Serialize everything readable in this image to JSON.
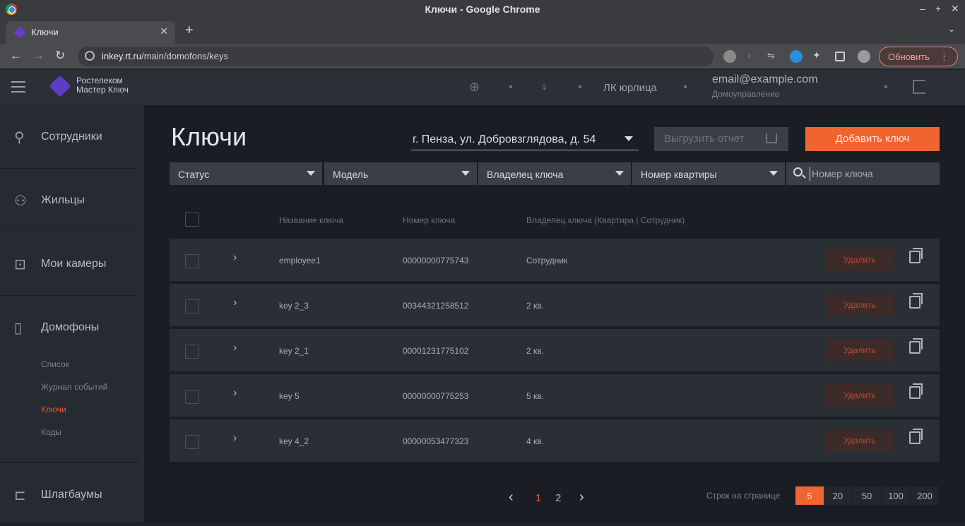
{
  "browser": {
    "window_title": "Ключи - Google Chrome",
    "tab_title": "Ключи",
    "url_host": "inkey.rt.ru",
    "url_path": "/main/domofons/keys",
    "update_label": "Обновить"
  },
  "header": {
    "logo_line1": "Ростелеком",
    "logo_line2": "Мастер Ключ",
    "lk_label": "ЛК юрлица",
    "email": "email@example.com",
    "org": "Домоуправление"
  },
  "sidebar": {
    "items": [
      {
        "label": "Сотрудники",
        "icon": "user-icon"
      },
      {
        "label": "Жильцы",
        "icon": "users-icon"
      },
      {
        "label": "Мои камеры",
        "icon": "camera-icon"
      },
      {
        "label": "Домофоны",
        "icon": "intercom-icon"
      },
      {
        "label": "Шлагбаумы",
        "icon": "barrier-icon"
      }
    ],
    "subitems": [
      "Список",
      "Журнал событий",
      "Ключи",
      "Коды"
    ],
    "active_subitem": "Ключи"
  },
  "main": {
    "title": "Ключи",
    "address": "г. Пенза, ул. Добровзглядова, д. 54",
    "export_label": "Выгрузить отчет",
    "add_label": "Добавить ключ",
    "filters": [
      "Статус",
      "Модель",
      "Владелец ключа",
      "Номер квартиры"
    ],
    "search_placeholder": "Номер ключа"
  },
  "table": {
    "columns": [
      "Название ключа",
      "Номер ключа",
      "Владелец ключа (Квартира | Сотрудник)"
    ],
    "delete_label": "Удалить",
    "rows": [
      {
        "name": "employee1",
        "number": "00000000775743",
        "owner": "Сотрудник"
      },
      {
        "name": "key 2_3",
        "number": "00344321258512",
        "owner": "2 кв."
      },
      {
        "name": "key 2_1",
        "number": "00001231775102",
        "owner": "2 кв."
      },
      {
        "name": "key 5",
        "number": "00000000775253",
        "owner": "5 кв."
      },
      {
        "name": "key 4_2",
        "number": "00000053477323",
        "owner": "4 кв."
      }
    ]
  },
  "pagination": {
    "pages": [
      "1",
      "2"
    ],
    "current_page": "1",
    "rows_per_page_label": "Строк на странице",
    "rows_per_page_options": [
      "5",
      "20",
      "50",
      "100",
      "200"
    ],
    "rows_per_page_selected": "5"
  },
  "colors": {
    "accent": "#f0642f",
    "background": "#1a1d23",
    "row": "#2a2e35"
  }
}
